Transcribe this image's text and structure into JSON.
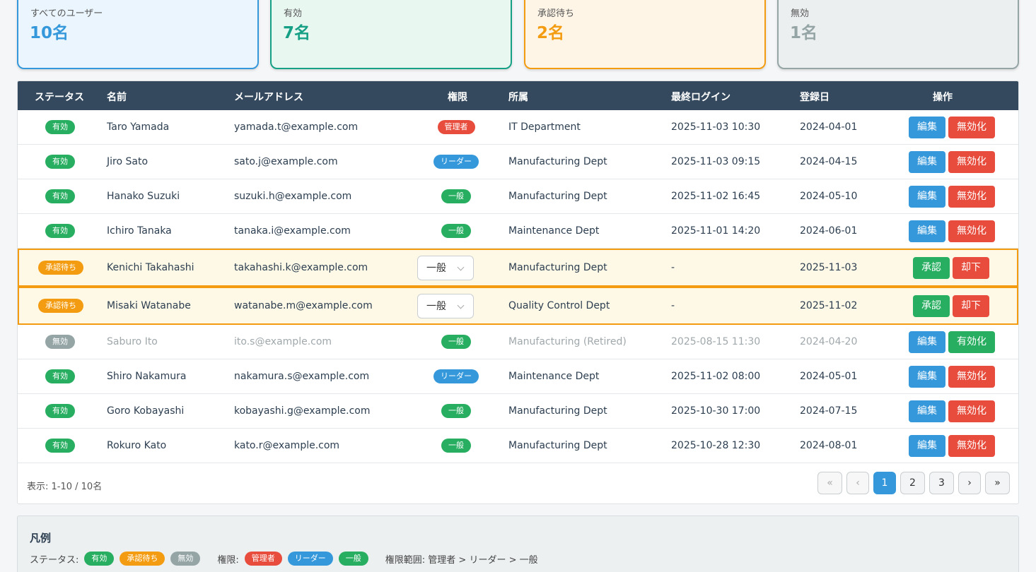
{
  "stats": {
    "all": {
      "label": "すべてのユーザー",
      "value": "10名"
    },
    "active": {
      "label": "有効",
      "value": "7名"
    },
    "pending": {
      "label": "承認待ち",
      "value": "2名"
    },
    "inactive": {
      "label": "無効",
      "value": "1名"
    }
  },
  "table": {
    "headers": [
      "ステータス",
      "名前",
      "メールアドレス",
      "権限",
      "所属",
      "最終ログイン",
      "登録日",
      "操作"
    ],
    "rows": [
      {
        "status": "有効",
        "name": "Taro Yamada",
        "email": "yamada.t@example.com",
        "role": "管理者",
        "dept": "IT Department",
        "last_login": "2025-11-03 10:30",
        "registered": "2024-04-01",
        "btn1": "編集",
        "btn2": "無効化"
      },
      {
        "status": "有効",
        "name": "Jiro Sato",
        "email": "sato.j@example.com",
        "role": "リーダー",
        "dept": "Manufacturing Dept",
        "last_login": "2025-11-03 09:15",
        "registered": "2024-04-15",
        "btn1": "編集",
        "btn2": "無効化"
      },
      {
        "status": "有効",
        "name": "Hanako Suzuki",
        "email": "suzuki.h@example.com",
        "role": "一般",
        "dept": "Manufacturing Dept",
        "last_login": "2025-11-02 16:45",
        "registered": "2024-05-10",
        "btn1": "編集",
        "btn2": "無効化"
      },
      {
        "status": "有効",
        "name": "Ichiro Tanaka",
        "email": "tanaka.i@example.com",
        "role": "一般",
        "dept": "Maintenance Dept",
        "last_login": "2025-11-01 14:20",
        "registered": "2024-06-01",
        "btn1": "編集",
        "btn2": "無効化"
      },
      {
        "status": "承認待ち",
        "name": "Kenichi Takahashi",
        "email": "takahashi.k@example.com",
        "role": "一般",
        "dept": "Manufacturing Dept",
        "last_login": "-",
        "registered": "2025-11-03",
        "btn1": "承認",
        "btn2": "却下"
      },
      {
        "status": "承認待ち",
        "name": "Misaki Watanabe",
        "email": "watanabe.m@example.com",
        "role": "一般",
        "dept": "Quality Control Dept",
        "last_login": "-",
        "registered": "2025-11-02",
        "btn1": "承認",
        "btn2": "却下"
      },
      {
        "status": "無効",
        "name": "Saburo Ito",
        "email": "ito.s@example.com",
        "role": "一般",
        "dept": "Manufacturing (Retired)",
        "last_login": "2025-08-15 11:30",
        "registered": "2024-04-20",
        "btn1": "編集",
        "btn2": "有効化"
      },
      {
        "status": "有効",
        "name": "Shiro Nakamura",
        "email": "nakamura.s@example.com",
        "role": "リーダー",
        "dept": "Maintenance Dept",
        "last_login": "2025-11-02 08:00",
        "registered": "2024-05-01",
        "btn1": "編集",
        "btn2": "無効化"
      },
      {
        "status": "有効",
        "name": "Goro Kobayashi",
        "email": "kobayashi.g@example.com",
        "role": "一般",
        "dept": "Manufacturing Dept",
        "last_login": "2025-10-30 17:00",
        "registered": "2024-07-15",
        "btn1": "編集",
        "btn2": "無効化"
      },
      {
        "status": "有効",
        "name": "Rokuro Kato",
        "email": "kato.r@example.com",
        "role": "一般",
        "dept": "Manufacturing Dept",
        "last_login": "2025-10-28 12:30",
        "registered": "2024-08-01",
        "btn1": "編集",
        "btn2": "無効化"
      }
    ],
    "display_info": "表示: 1-10 / 10名"
  },
  "pagination": {
    "first": "«",
    "prev": "‹",
    "pages": [
      "1",
      "2",
      "3"
    ],
    "next": "›",
    "last": "»"
  },
  "legend": {
    "title": "凡例",
    "status_label": "ステータス:",
    "status_active": "有効",
    "status_pending": "承認待ち",
    "status_inactive": "無効",
    "role_label": "権限:",
    "role_admin": "管理者",
    "role_leader": "リーダー",
    "role_general": "一般",
    "scope": "権限範囲: 管理者 > リーダー > 一般"
  },
  "colors": {
    "header_bg": "#34495e",
    "active": "#27ae60",
    "pending": "#f39c12",
    "inactive": "#95a5a6",
    "admin": "#e74c3c",
    "leader": "#3498db",
    "primary": "#3498db"
  }
}
